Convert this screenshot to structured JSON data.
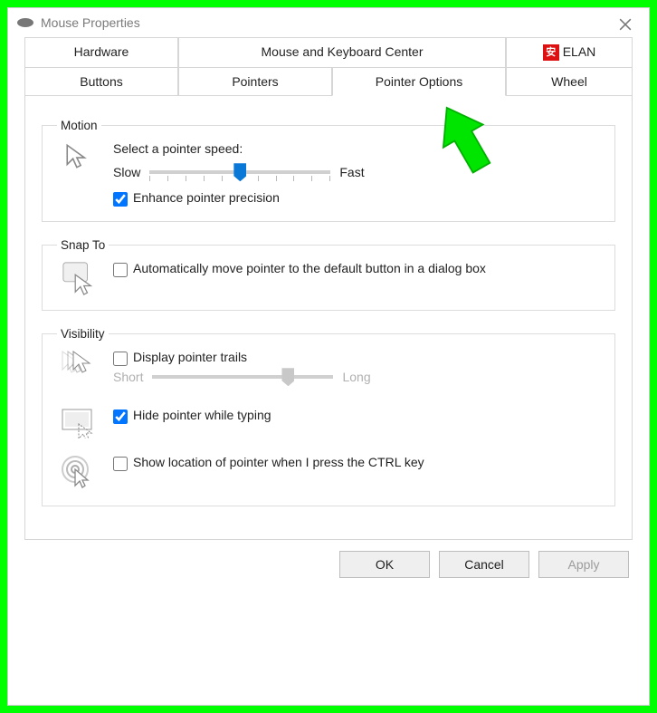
{
  "window": {
    "title": "Mouse Properties"
  },
  "tabs": {
    "row1": [
      {
        "label": "Hardware"
      },
      {
        "label": "Mouse and Keyboard Center"
      },
      {
        "label": "ELAN",
        "icon": "elan"
      }
    ],
    "row2": [
      {
        "label": "Buttons"
      },
      {
        "label": "Pointers"
      },
      {
        "label": "Pointer Options",
        "active": true
      },
      {
        "label": "Wheel"
      }
    ]
  },
  "motion": {
    "legend": "Motion",
    "speed_label": "Select a pointer speed:",
    "slow": "Slow",
    "fast": "Fast",
    "enhance": "Enhance pointer precision",
    "enhance_checked": true,
    "speed_value": 6,
    "speed_max": 11
  },
  "snap": {
    "legend": "Snap To",
    "label": "Automatically move pointer to the default button in a dialog box",
    "checked": false
  },
  "visibility": {
    "legend": "Visibility",
    "trails": "Display pointer trails",
    "trails_checked": false,
    "short": "Short",
    "long": "Long",
    "hide": "Hide pointer while typing",
    "hide_checked": true,
    "ctrl": "Show location of pointer when I press the CTRL key",
    "ctrl_checked": false
  },
  "footer": {
    "ok": "OK",
    "cancel": "Cancel",
    "apply": "Apply"
  }
}
